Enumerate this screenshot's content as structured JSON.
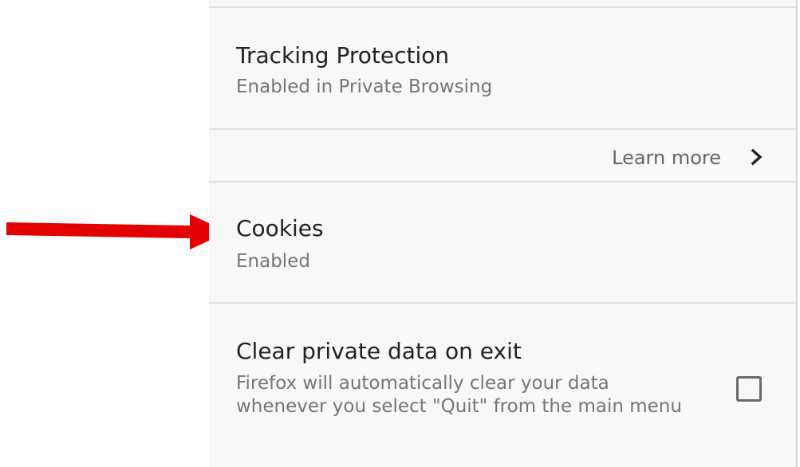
{
  "settings": {
    "tracking_protection": {
      "title": "Tracking Protection",
      "subtitle": "Enabled in Private Browsing"
    },
    "learn_more": {
      "label": "Learn more",
      "icon": "chevron-right-icon"
    },
    "cookies": {
      "title": "Cookies",
      "subtitle": "Enabled"
    },
    "clear_private_data": {
      "title": "Clear private data on exit",
      "subtitle": "Firefox will automatically clear your data whenever you select \"Quit\" from the main menu",
      "checked": false
    }
  },
  "annotation": {
    "arrow_color": "#e30000",
    "points_to": "cookies"
  }
}
